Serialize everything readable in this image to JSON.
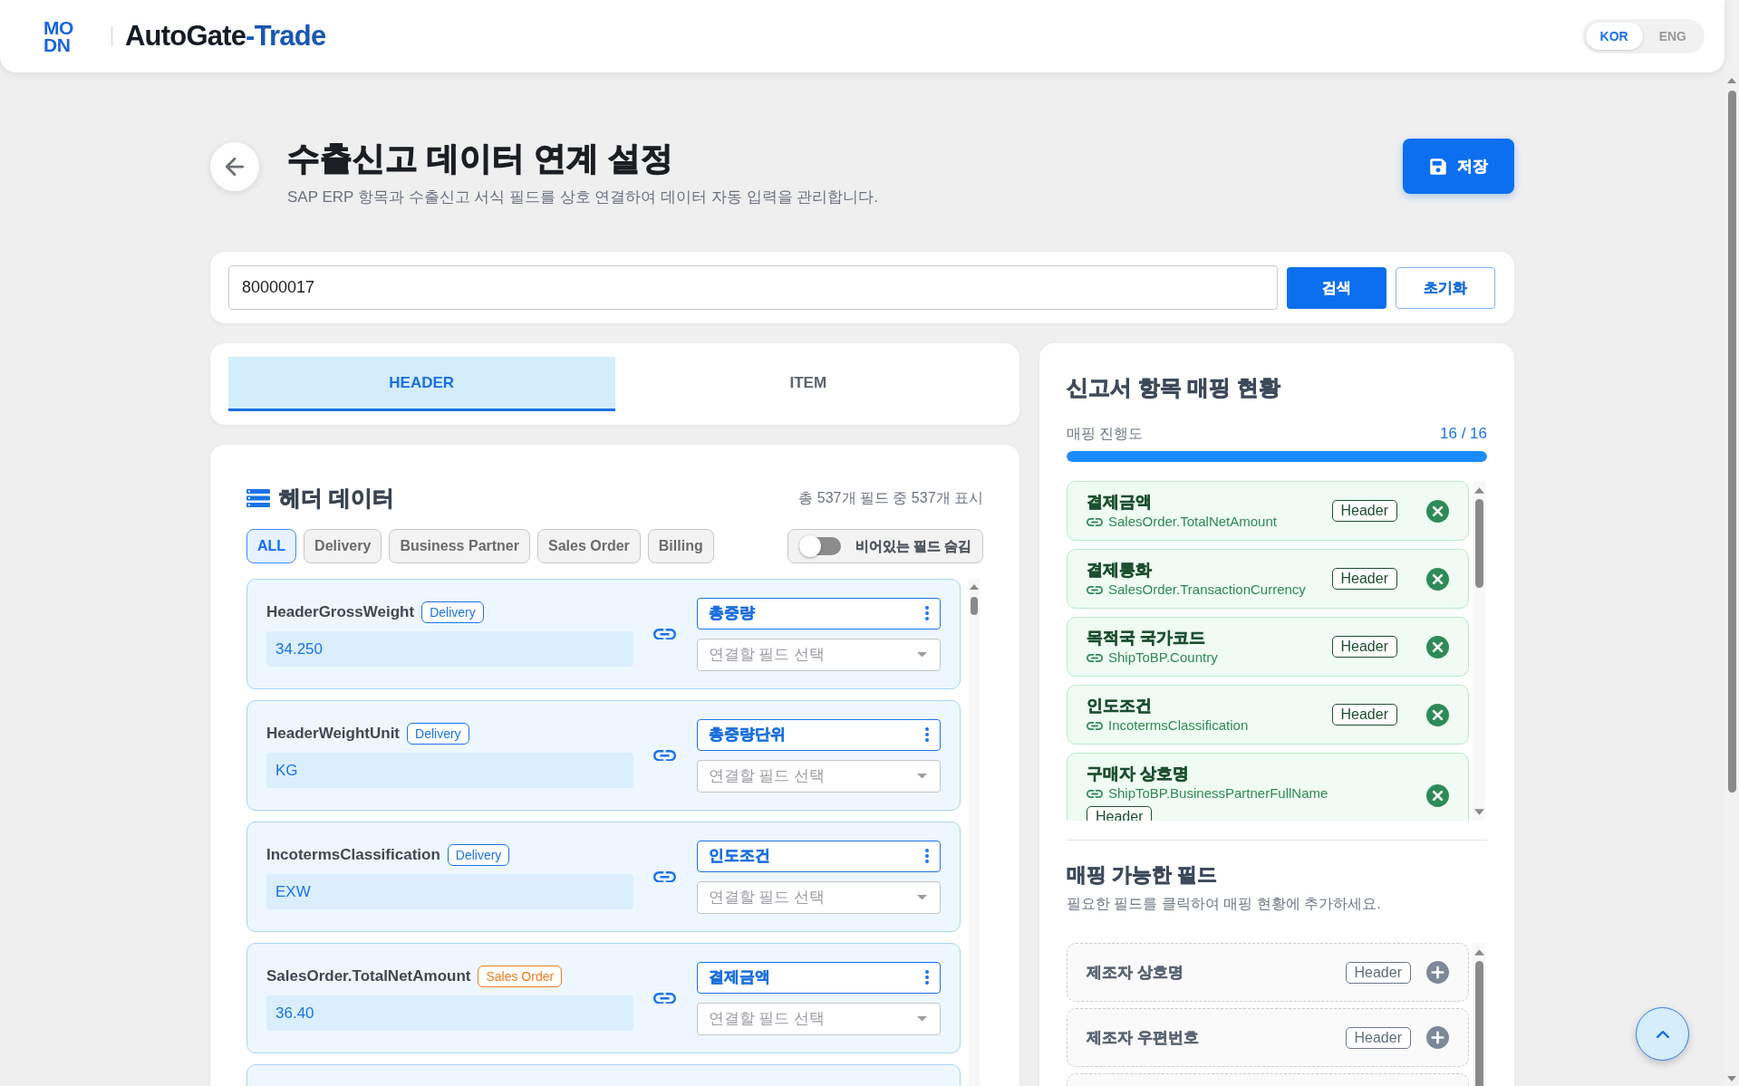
{
  "header": {
    "logo": [
      "MO",
      "DN"
    ],
    "app_name": "AutoGate",
    "app_name_accent": "-Trade",
    "languages": [
      {
        "label": "KOR",
        "selected": true
      },
      {
        "label": "ENG",
        "selected": false
      }
    ]
  },
  "page": {
    "title": "수출신고 데이터 연계 설정",
    "subtitle": "SAP ERP 항목과 수출신고 서식 필드를 상호 연결하여 데이터 자동 입력을 관리합니다.",
    "save_button": "저장"
  },
  "search": {
    "value": "80000017",
    "search_button": "검색",
    "reset_button": "초기화"
  },
  "tabs": [
    {
      "label": "HEADER",
      "selected": true
    },
    {
      "label": "ITEM",
      "selected": false
    }
  ],
  "header_data": {
    "title": "헤더 데이터",
    "count": "총 537개 필드 중 537개 표시",
    "filters": [
      {
        "label": "ALL",
        "selected": true
      },
      {
        "label": "Delivery",
        "selected": false
      },
      {
        "label": "Business Partner",
        "selected": false
      },
      {
        "label": "Sales Order",
        "selected": false
      },
      {
        "label": "Billing",
        "selected": false
      }
    ],
    "hide_empty": {
      "label": "비어있는 필드 숨김",
      "on": false
    },
    "rows": [
      {
        "kind": "field",
        "name": "HeaderGrossWeight",
        "source": "Delivery",
        "color": "#1a73e8",
        "value": "34.250",
        "mapped": "총중량",
        "placeholder": "연결할 필드 선택"
      },
      {
        "kind": "field",
        "name": "HeaderWeightUnit",
        "source": "Delivery",
        "color": "#1a73e8",
        "value": "KG",
        "mapped": "총중량단위",
        "placeholder": "연결할 필드 선택"
      },
      {
        "kind": "field",
        "name": "IncotermsClassification",
        "source": "Delivery",
        "color": "#1a73e8",
        "value": "EXW",
        "mapped": "인도조건",
        "placeholder": "연결할 필드 선택"
      },
      {
        "kind": "field",
        "name": "SalesOrder.TotalNetAmount",
        "source": "Sales Order",
        "color": "#f07c1e",
        "value": "36.40",
        "mapped": "결제금액",
        "placeholder": "연결할 필드 선택"
      },
      {
        "kind": "clipped"
      }
    ]
  },
  "mapping_status": {
    "title": "신고서 항목 매핑 현황",
    "progress": {
      "label": "매핑 진행도",
      "reading": "16 / 16",
      "level": 1
    },
    "mapped": [
      {
        "name": "결제금액",
        "path": "SalesOrder.TotalNetAmount",
        "tag": "Header"
      },
      {
        "name": "결제통화",
        "path": "SalesOrder.TransactionCurrency",
        "tag": "Header"
      },
      {
        "name": "목적국 국가코드",
        "path": "ShipToBP.Country",
        "tag": "Header"
      },
      {
        "name": "인도조건",
        "path": "IncotermsClassification",
        "tag": "Header"
      },
      {
        "name": "구매자 상호명",
        "path": "ShipToBP.BusinessPartnerFullName",
        "tag": "Header"
      }
    ]
  },
  "available": {
    "title": "매핑 가능한 필드",
    "hint": "필요한 필드를 클릭하여 매핑 현황에 추가하세요.",
    "items": [
      {
        "kind": "field",
        "name": "제조자 상호명",
        "tag": "Header"
      },
      {
        "kind": "field",
        "name": "제조자 우편번호",
        "tag": "Header"
      },
      {
        "kind": "clipped"
      }
    ]
  }
}
